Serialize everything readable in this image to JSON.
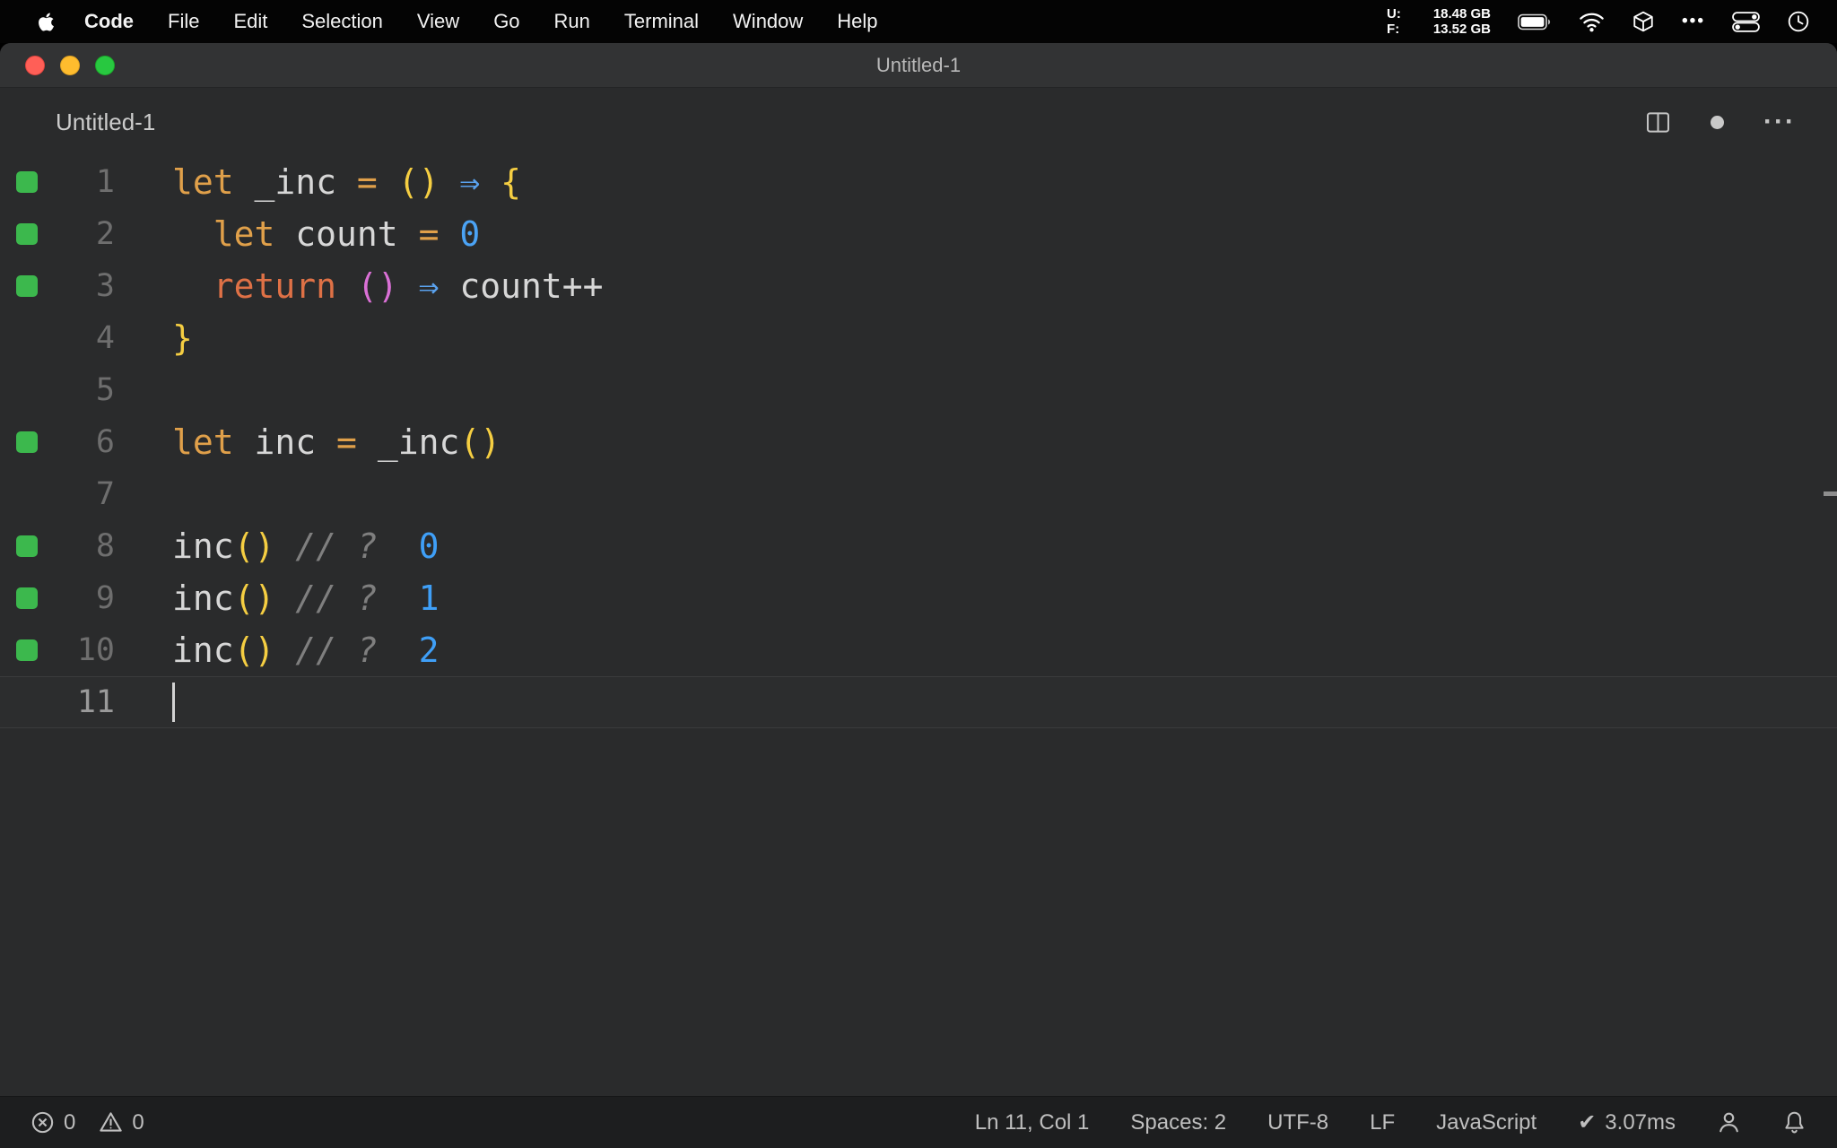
{
  "menu_bar": {
    "app_name": "Code",
    "items": [
      "File",
      "Edit",
      "Selection",
      "View",
      "Go",
      "Run",
      "Terminal",
      "Window",
      "Help"
    ],
    "memory": {
      "used_label": "U:",
      "used_value": "18.48 GB",
      "free_label": "F:",
      "free_value": "13.52 GB"
    },
    "ellipsis_glyph": "•••"
  },
  "window": {
    "title": "Untitled-1"
  },
  "editor": {
    "tab_label": "Untitled-1",
    "more_actions_glyph": "···",
    "lines": [
      {
        "num": "1",
        "covered": true,
        "tokens": [
          {
            "t": "let",
            "c": "kw"
          },
          {
            "t": " _inc ",
            "c": "fg"
          },
          {
            "t": "=",
            "c": "op"
          },
          {
            "t": " ",
            "c": "fg"
          },
          {
            "t": "()",
            "c": "b1"
          },
          {
            "t": " ",
            "c": "fg"
          },
          {
            "t": "⇒",
            "c": "arrow"
          },
          {
            "t": " ",
            "c": "fg"
          },
          {
            "t": "{",
            "c": "b1"
          }
        ]
      },
      {
        "num": "2",
        "covered": true,
        "tokens": [
          {
            "t": "  ",
            "c": "fg"
          },
          {
            "t": "let",
            "c": "kw"
          },
          {
            "t": " count ",
            "c": "fg"
          },
          {
            "t": "=",
            "c": "op"
          },
          {
            "t": " ",
            "c": "fg"
          },
          {
            "t": "0",
            "c": "num"
          }
        ]
      },
      {
        "num": "3",
        "covered": true,
        "tokens": [
          {
            "t": "  ",
            "c": "fg"
          },
          {
            "t": "return",
            "c": "ret"
          },
          {
            "t": " ",
            "c": "fg"
          },
          {
            "t": "()",
            "c": "b2"
          },
          {
            "t": " ",
            "c": "fg"
          },
          {
            "t": "⇒",
            "c": "arrow"
          },
          {
            "t": " count",
            "c": "fg"
          },
          {
            "t": "++",
            "c": "fg"
          }
        ]
      },
      {
        "num": "4",
        "covered": false,
        "tokens": [
          {
            "t": "}",
            "c": "b1"
          }
        ]
      },
      {
        "num": "5",
        "covered": false,
        "tokens": []
      },
      {
        "num": "6",
        "covered": true,
        "tokens": [
          {
            "t": "let",
            "c": "kw"
          },
          {
            "t": " inc ",
            "c": "fg"
          },
          {
            "t": "=",
            "c": "op"
          },
          {
            "t": " ",
            "c": "fg"
          },
          {
            "t": "_inc",
            "c": "fg"
          },
          {
            "t": "()",
            "c": "b1"
          }
        ]
      },
      {
        "num": "7",
        "covered": false,
        "tokens": []
      },
      {
        "num": "8",
        "covered": true,
        "tokens": [
          {
            "t": "inc",
            "c": "fg"
          },
          {
            "t": "()",
            "c": "b1"
          },
          {
            "t": " ",
            "c": "fg"
          },
          {
            "t": "// ?",
            "c": "comment"
          },
          {
            "t": "  ",
            "c": "fg"
          },
          {
            "t": "0",
            "c": "result"
          }
        ]
      },
      {
        "num": "9",
        "covered": true,
        "tokens": [
          {
            "t": "inc",
            "c": "fg"
          },
          {
            "t": "()",
            "c": "b1"
          },
          {
            "t": " ",
            "c": "fg"
          },
          {
            "t": "// ?",
            "c": "comment"
          },
          {
            "t": "  ",
            "c": "fg"
          },
          {
            "t": "1",
            "c": "result"
          }
        ]
      },
      {
        "num": "10",
        "covered": true,
        "tokens": [
          {
            "t": "inc",
            "c": "fg"
          },
          {
            "t": "()",
            "c": "b1"
          },
          {
            "t": " ",
            "c": "fg"
          },
          {
            "t": "// ?",
            "c": "comment"
          },
          {
            "t": "  ",
            "c": "fg"
          },
          {
            "t": "2",
            "c": "result"
          }
        ]
      },
      {
        "num": "11",
        "covered": false,
        "cursor": true,
        "tokens": []
      }
    ]
  },
  "status_bar": {
    "errors": "0",
    "warnings": "0",
    "cursor_position": "Ln 11, Col 1",
    "indentation": "Spaces: 2",
    "encoding": "UTF-8",
    "eol": "LF",
    "language": "JavaScript",
    "check_glyph": "✔",
    "perf_time": "3.07ms"
  },
  "colors": {
    "keyword": "#e0a04a",
    "keyword_return": "#df7146",
    "operator": "#e0a04a",
    "bracket_level1": "#f5ce42",
    "bracket_level2": "#da70d6",
    "arrow": "#5aa2ee",
    "number": "#4ba3f5",
    "result_value": "#3f9ff7",
    "identifier": "#d7d7d7",
    "comment": "#7f7f7f",
    "coverage_green": "#3cb84d"
  }
}
